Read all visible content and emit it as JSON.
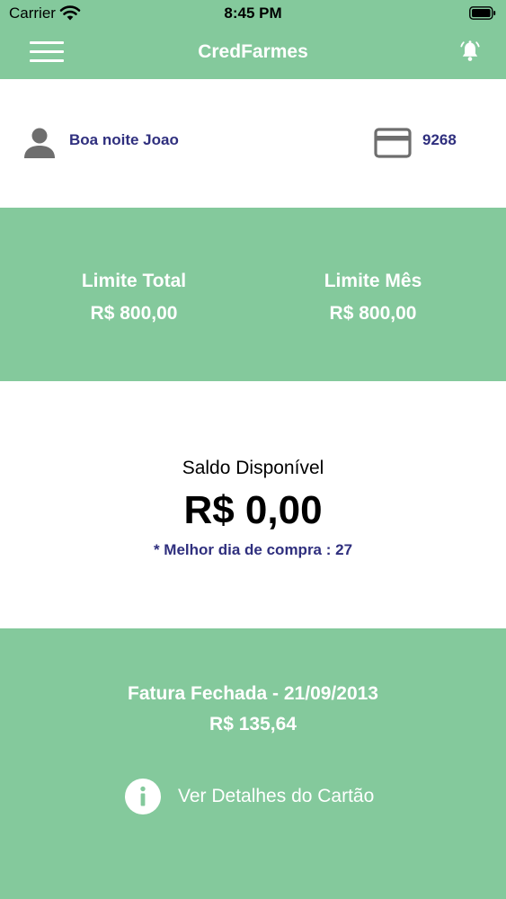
{
  "status_bar": {
    "carrier": "Carrier",
    "time": "8:45 PM"
  },
  "nav": {
    "title": "CredFarmes",
    "menu_icon": "hamburger-menu-icon",
    "bell_icon": "bell-icon"
  },
  "user": {
    "greeting": "Boa noite Joao",
    "card_number": "9268",
    "user_icon": "person-icon",
    "card_icon": "credit-card-icon"
  },
  "limits": {
    "total_label": "Limite Total",
    "total_value": "R$ 800,00",
    "month_label": "Limite Mês",
    "month_value": "R$ 800,00"
  },
  "balance": {
    "label": "Saldo Disponível",
    "value": "R$ 0,00",
    "best_day": "* Melhor dia de compra : 27"
  },
  "invoice": {
    "title": "Fatura Fechada - 21/09/2013",
    "value": "R$ 135,64",
    "details_label": "Ver Detalhes do Cartão",
    "details_icon": "info-icon"
  },
  "colors": {
    "accent_green": "#84c99c",
    "text_navy": "#2f2f7e",
    "icon_gray": "#6e6e6e"
  }
}
